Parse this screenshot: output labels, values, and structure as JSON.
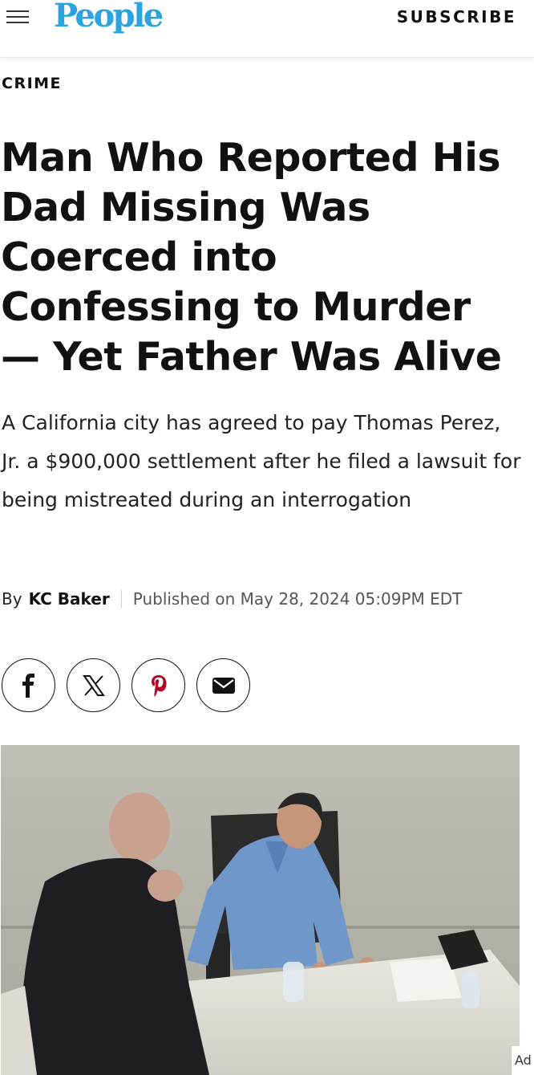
{
  "header": {
    "menu_icon": "hamburger-menu-icon",
    "logo_text": "People",
    "subscribe_label": "SUBSCRIBE",
    "logo_color": "#2aa3e0"
  },
  "article": {
    "category": "CRIME",
    "headline": "Man Who Reported His Dad Missing Was Coerced into Confessing to Murder — Yet Father Was Alive",
    "dek": "A California city has agreed to pay Thomas Perez, Jr. a $900,000 settlement after he filed a lawsuit for being mistreated during an interrogation",
    "byline": {
      "by_label": "By",
      "author": "KC Baker",
      "published": "Published on May 28, 2024 05:09PM EDT"
    },
    "share": [
      {
        "name": "facebook",
        "icon": "facebook-icon"
      },
      {
        "name": "x",
        "icon": "x-icon"
      },
      {
        "name": "pinterest",
        "icon": "pinterest-icon"
      },
      {
        "name": "email",
        "icon": "email-icon"
      }
    ],
    "hero_image": {
      "description_icon": "interrogation-room-photo"
    }
  },
  "ad": {
    "label": "Ad"
  }
}
